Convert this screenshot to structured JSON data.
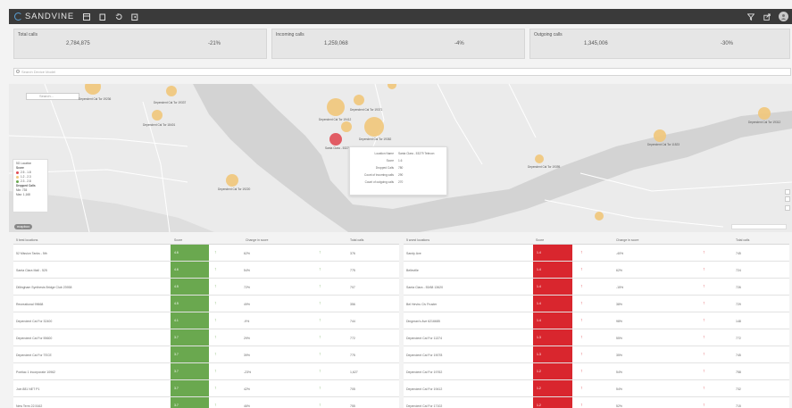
{
  "app": {
    "brand": "SANDVINE"
  },
  "kpis": [
    {
      "label": "Total calls",
      "value": "2,784,875",
      "change": "-21%"
    },
    {
      "label": "Incoming calls",
      "value": "1,259,068",
      "change": "-4%"
    },
    {
      "label": "Outgoing calls",
      "value": "1,345,006",
      "change": "-30%"
    }
  ],
  "search": {
    "placeholder": "Search Device Model"
  },
  "map": {
    "search_placeholder": "Search...",
    "legend": {
      "title": "5G Location",
      "score_label": "Score",
      "items": [
        {
          "label": "2.5 - 1.8",
          "color": "#e04c55"
        },
        {
          "label": "1.2 - 2.3",
          "color": "#f1c77a"
        },
        {
          "label": "2.3 - 2.8",
          "color": "#6aa84f"
        }
      ],
      "size_label": "Dropped Calls",
      "size_items": [
        "Min: 735",
        "Max: 1,168"
      ]
    },
    "bubbles": [
      {
        "label": "Dependent Cal Tor 19236",
        "color": "amber"
      },
      {
        "label": "Dependent Cal Tor 19337",
        "color": "amber"
      },
      {
        "label": "Dependent Cal Tor 18401",
        "color": "amber"
      },
      {
        "label": "Dependent Cal Tor 19412",
        "color": "amber"
      },
      {
        "label": "Dependent Cal Tor 19371",
        "color": "amber"
      },
      {
        "label": "Dependent Cal Tor 19382",
        "color": "amber"
      },
      {
        "label": "Santa Clara - 53279",
        "color": "red"
      },
      {
        "label": "Dependent Cal Tor 19220",
        "color": "amber"
      },
      {
        "label": "Dependent Cal Tor 11523",
        "color": "amber"
      },
      {
        "label": "Dependent Cal Tor 19312",
        "color": "amber"
      },
      {
        "label": "Dependent Cal Tor 19395",
        "color": "amber"
      }
    ],
    "tooltip": [
      {
        "k": "Location Name",
        "v": "Santa Clara - 53279 Telecon"
      },
      {
        "k": "Score",
        "v": "1.6"
      },
      {
        "k": "Dropped Calls",
        "v": "780"
      },
      {
        "k": "Count of incoming calls",
        "v": "290"
      },
      {
        "k": "Count of outgoing calls",
        "v": "270"
      }
    ]
  },
  "tables": [
    {
      "headers": [
        "5 best locations",
        "Score",
        "Change in score",
        "Total calls"
      ],
      "score_color": "#6aa84f",
      "arrow_color": "#6aa84f",
      "rows": [
        {
          "name": "52 Mission Tanks - 5th",
          "score": "4.6",
          "change": "62%",
          "calls": "376"
        },
        {
          "name": "Santa Clara Mall - 525",
          "score": "4.6",
          "change": "54%",
          "calls": "775"
        },
        {
          "name": "Dillingham Synthesis Bridge Club 23938",
          "score": "4.5",
          "change": "72%",
          "calls": "707"
        },
        {
          "name": "Recreational 99668",
          "score": "4.5",
          "change": "49%",
          "calls": "356"
        },
        {
          "name": "Dependent Cal For 32400",
          "score": "4.1",
          "change": "-9%",
          "calls": "744"
        },
        {
          "name": "Dependent Cal For 55600",
          "score": "3.7",
          "change": "29%",
          "calls": "772"
        },
        {
          "name": "Dependent Cal For TECE",
          "score": "3.7",
          "change": "39%",
          "calls": "775"
        },
        {
          "name": "Pontiac 1 Incorporate 10962",
          "score": "3.7",
          "change": "-23%",
          "calls": "1,627"
        },
        {
          "name": "Join 881 NET P1",
          "score": "3.7",
          "change": "42%",
          "calls": "705"
        },
        {
          "name": "New Term 22.5162",
          "score": "3.7",
          "change": "46%",
          "calls": "755"
        }
      ]
    },
    {
      "headers": [
        "5 worst locations",
        "Score",
        "Change in score",
        "Total calls"
      ],
      "score_color": "#d9262e",
      "arrow_color": "#d9262e",
      "rows": [
        {
          "name": "Sandy Ave",
          "score": "1.4",
          "change": "-40%",
          "calls": "745"
        },
        {
          "name": "Belleville",
          "score": "1.4",
          "change": "62%",
          "calls": "724"
        },
        {
          "name": "Santa Clara - 53/68 13620",
          "score": "1.4",
          "change": "-15%",
          "calls": "726"
        },
        {
          "name": "Bel Heviru Civ Fruster",
          "score": "1.4",
          "change": "38%",
          "calls": "729"
        },
        {
          "name": "Dingman's Ave 6216685",
          "score": "1.4",
          "change": "98%",
          "calls": "148"
        },
        {
          "name": "Dependent Cal For 11374",
          "score": "1.3",
          "change": "55%",
          "calls": "772"
        },
        {
          "name": "Dependent Cal For 19078",
          "score": "1.3",
          "change": "35%",
          "calls": "745"
        },
        {
          "name": "Dependent Cal For 19762",
          "score": "1.2",
          "change": "54%",
          "calls": "758"
        },
        {
          "name": "Dependent Cal For 19412",
          "score": "1.2",
          "change": "54%",
          "calls": "732"
        },
        {
          "name": "Dependent Cal For 17102",
          "score": "1.2",
          "change": "52%",
          "calls": "715"
        }
      ]
    }
  ]
}
